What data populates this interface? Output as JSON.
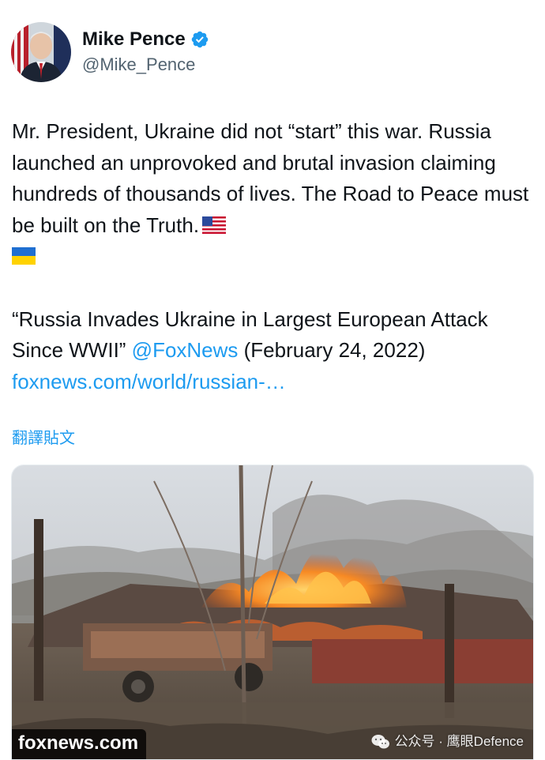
{
  "author": {
    "name": "Mike Pence",
    "handle": "@Mike_Pence",
    "verified": true,
    "accent": "#1d9bf0"
  },
  "tweet": {
    "line1": "Mr. President, Ukraine did not “start” this war. Russia launched an unprovoked and brutal invasion claiming hundreds of thousands of lives. The Road to Peace must be built on the Truth.",
    "quote_text": "“Russia Invades Ukraine in Largest European Attack Since WWII” ",
    "mention": "@FoxNews",
    "date_text": " (February 24, 2022) ",
    "link_text": "foxnews.com/world/russian-…",
    "emoji": [
      "us-flag-icon",
      "ukraine-flag-icon"
    ]
  },
  "translate_label": "翻譯貼文",
  "media": {
    "source_label": "foxnews.com",
    "watermark": "公众号 · 鹰眼Defence",
    "watermark_icon": "wechat-icon"
  },
  "colors": {
    "text": "#0f1419",
    "secondary": "#536471",
    "link": "#1d9bf0"
  }
}
